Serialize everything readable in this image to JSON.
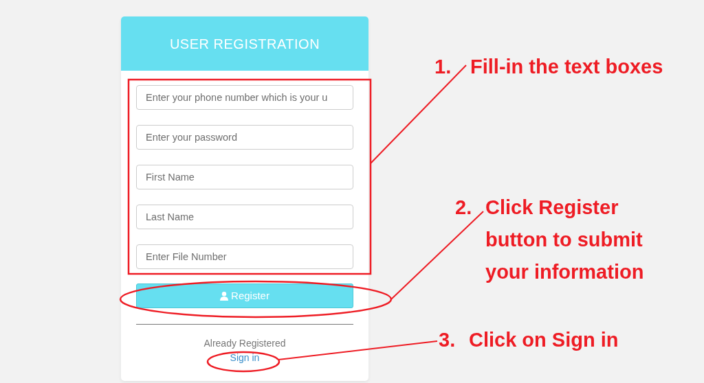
{
  "card": {
    "title": "USER REGISTRATION",
    "fields": [
      {
        "placeholder": "Enter your phone number which is your u"
      },
      {
        "placeholder": "Enter your password"
      },
      {
        "placeholder": "First Name"
      },
      {
        "placeholder": "Last Name"
      },
      {
        "placeholder": "Enter File Number"
      }
    ],
    "register_button": "Register",
    "prompt": "Already Registered",
    "sign_in_link": "Sign in"
  },
  "annotations": [
    {
      "kind": "rect",
      "number": "1.",
      "lines": [
        "Fill-in the text boxes"
      ]
    },
    {
      "kind": "ellipse",
      "number": "2.",
      "lines": [
        "Click Register",
        "button to submit",
        "your information"
      ]
    },
    {
      "kind": "ellipse",
      "number": "3.",
      "lines": [
        "Click on Sign in"
      ]
    }
  ]
}
